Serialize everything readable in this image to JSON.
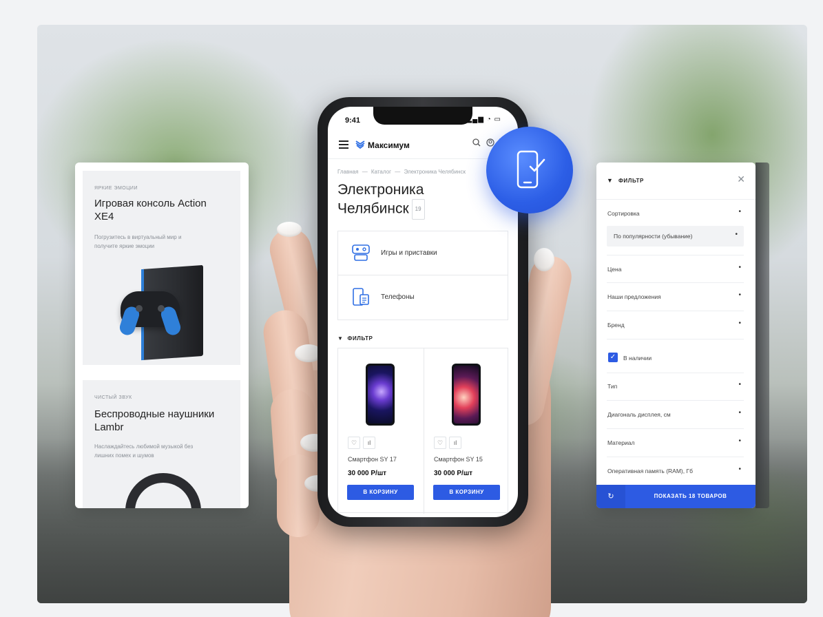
{
  "promo": [
    {
      "kicker": "яркие эмоции",
      "title": "Игровая консоль Action XE4",
      "desc": "Погрузитесь в виртуальный мир и получите яркие эмоции"
    },
    {
      "kicker": "чистый звук",
      "title": "Беспроводные наушники Lambr",
      "desc": "Наслаждайтесь любимой музыкой без лишних помех и шумов"
    }
  ],
  "phone": {
    "status_time": "9:41",
    "logo": "Максимум",
    "breadcrumb": [
      "Главная",
      "—",
      "Каталог",
      "—",
      "Электроника Челябинск"
    ],
    "title": "Электроника Челябинск",
    "count": "19",
    "categories": [
      {
        "label": "Игры и приставки",
        "icon": "gamepad-icon"
      },
      {
        "label": "Телефоны",
        "icon": "phone-icon"
      }
    ],
    "filter_label": "ФИЛЬТР",
    "products": [
      {
        "name": "Смартфон SY 17",
        "price": "30 000 Р/шт",
        "button": "В КОРЗИНУ"
      },
      {
        "name": "Смартфон SY 15",
        "price": "30 000 Р/шт",
        "button": "В КОРЗИНУ"
      }
    ]
  },
  "filter_panel": {
    "title": "ФИЛЬТР",
    "sort_label": "Сортировка",
    "sort_value": "По популярности (убывание)",
    "rows": [
      "Цена",
      "Наши предложения",
      "Бренд"
    ],
    "in_stock": "В наличии",
    "rows_after": [
      "Тип",
      "Диагональ дисплея, см",
      "Материал",
      "Оперативная память (RAM), Гб"
    ],
    "show_button": "ПОКАЗАТЬ 18 ТОВАРОВ"
  },
  "colors": {
    "accent": "#2d5be3",
    "logo": "#2f6fe4"
  }
}
